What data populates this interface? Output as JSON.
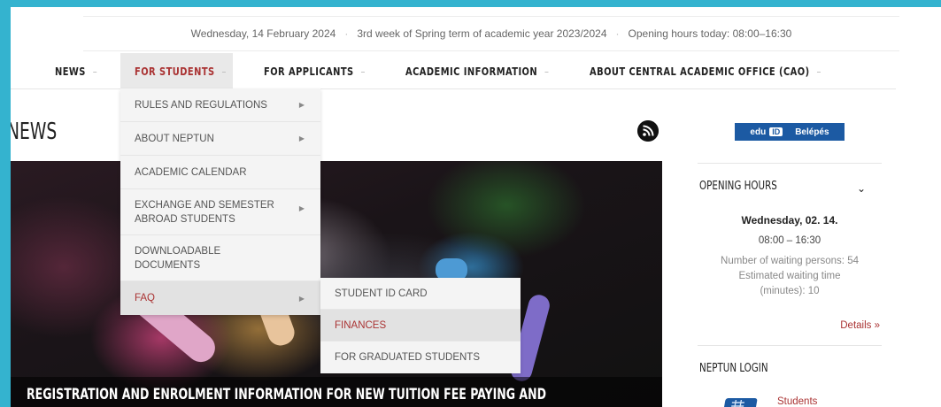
{
  "info_bar": {
    "date": "Wednesday, 14 February 2024",
    "week": "3rd week of Spring term of academic year 2023/2024",
    "hours": "Opening hours today: 08:00–16:30",
    "separator": "·"
  },
  "nav": {
    "items": [
      {
        "label": "NEWS",
        "caret": "–"
      },
      {
        "label": "FOR STUDENTS",
        "caret": "–"
      },
      {
        "label": "FOR APPLICANTS",
        "caret": "–"
      },
      {
        "label": "ACADEMIC INFORMATION",
        "caret": "–"
      },
      {
        "label": "ABOUT CENTRAL ACADEMIC OFFICE (CAO)",
        "caret": "–"
      }
    ],
    "active_index": 1
  },
  "dropdown": {
    "items": [
      {
        "label": "RULES AND REGULATIONS",
        "has_sub": true
      },
      {
        "label": "ABOUT NEPTUN",
        "has_sub": true
      },
      {
        "label": "ACADEMIC CALENDAR",
        "has_sub": false
      },
      {
        "label": "EXCHANGE AND SEMESTER ABROAD STUDENTS",
        "has_sub": true
      },
      {
        "label": "DOWNLOADABLE DOCUMENTS",
        "has_sub": false
      },
      {
        "label": "FAQ",
        "has_sub": true
      }
    ],
    "arrow": "▶",
    "submenu": [
      "STUDENT ID CARD",
      "FINANCES",
      "FOR GRADUATED STUDENTS"
    ],
    "active_sub": "FINANCES"
  },
  "main": {
    "heading": "NEWS",
    "rss_icon": "rss-icon",
    "hero_caption": "REGISTRATION AND ENROLMENT INFORMATION FOR NEW TUITION FEE PAYING AND"
  },
  "sidebar": {
    "edu_logo": "edu",
    "edu_id": "ID",
    "login_button": "Belépés",
    "opening_hours": {
      "title": "OPENING HOURS",
      "chevron": "⌄",
      "day": "Wednesday, 02. 14.",
      "time": "08:00 – 16:30",
      "waiting": "Number of waiting persons: 54",
      "estimated": "Estimated waiting time (minutes): 10",
      "details": "Details »"
    },
    "neptun": {
      "title": "NEPTUN LOGIN",
      "students": "Students"
    }
  },
  "colors": {
    "accent": "#aa3333",
    "background": "#34b3cf",
    "edu_blue": "#1c5aa3"
  }
}
